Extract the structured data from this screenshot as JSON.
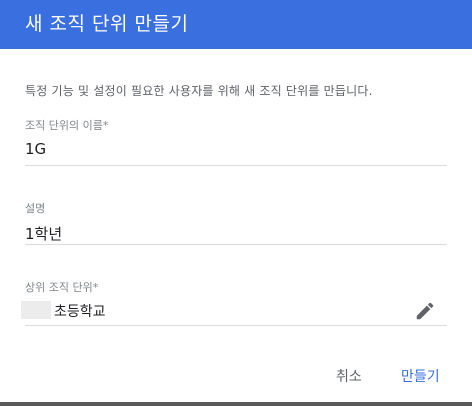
{
  "dialog": {
    "title": "새 조직 단위 만들기",
    "description": "특정 기능 및 설정이 필요한 사용자를 위해 새 조직 단위를 만듭니다."
  },
  "fields": {
    "name": {
      "label": "조직 단위의 이름*",
      "value": "1G"
    },
    "description": {
      "label": "설명",
      "value": "1학년"
    },
    "parent": {
      "label": "상위 조직 단위*",
      "value": "초등학교",
      "edit_icon": "pencil-icon"
    }
  },
  "actions": {
    "cancel_label": "취소",
    "create_label": "만들기"
  },
  "colors": {
    "header": "#3a6fe0",
    "primary": "#3a6fe0"
  }
}
